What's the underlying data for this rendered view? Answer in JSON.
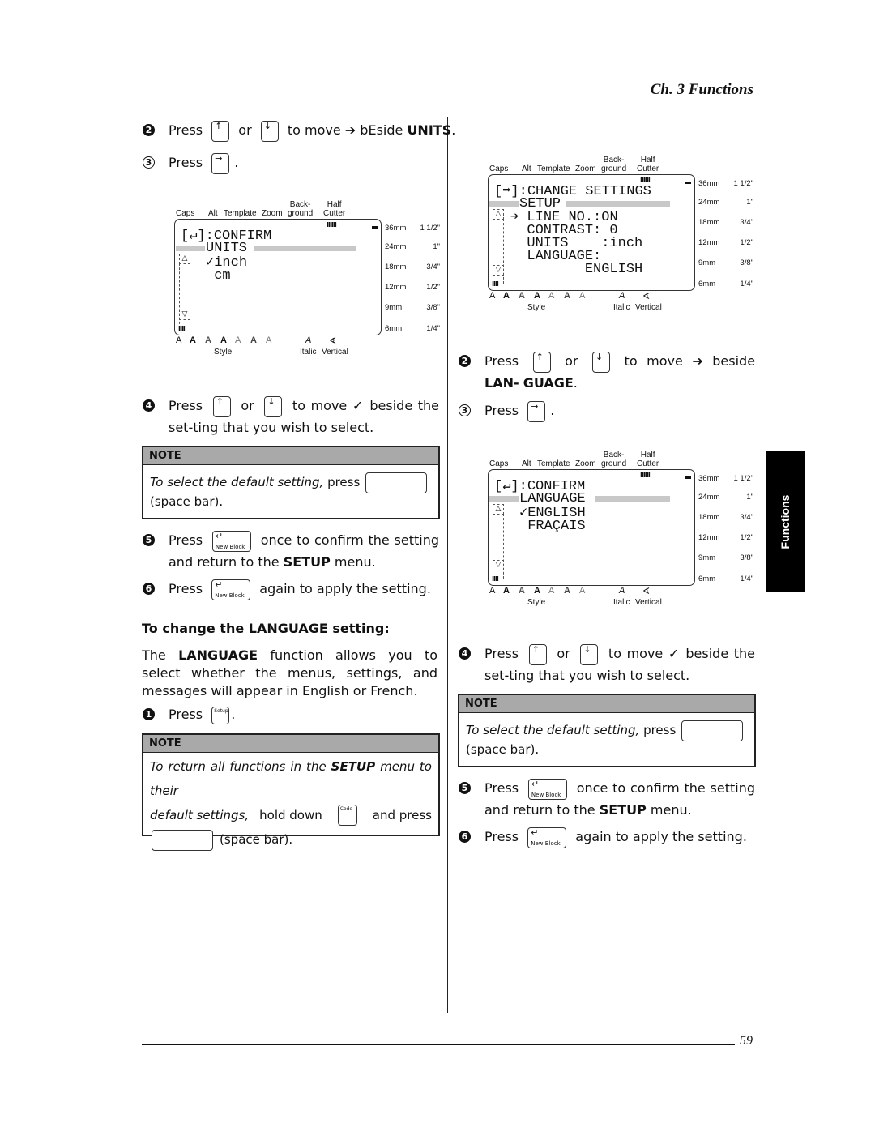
{
  "header": {
    "chapter": "Ch. 3 Functions"
  },
  "side_tab": {
    "label": "Functions"
  },
  "footer": {
    "page_number": "59"
  },
  "keys": {
    "up_icon": "↑",
    "down_icon": "↓",
    "right_icon": "→",
    "enter_icon": "↵",
    "new_block": "New Block",
    "setup": "Setup",
    "code": "Code"
  },
  "left": {
    "step2": {
      "num": "2",
      "press": "Press",
      "or": "or",
      "rest_a": "to move",
      "arrow": "➔",
      "rest_b": "bEside",
      "kw": "UNITS",
      "end": "."
    },
    "step3": {
      "num": "3",
      "press": "Press",
      "end": "."
    },
    "lcd1": {
      "icon": "[↵]",
      "title": ":CONFIRM",
      "section": "UNITS",
      "items": [
        "✓inch",
        " cm"
      ]
    },
    "step4": {
      "num": "4",
      "press": "Press",
      "or": "or",
      "rest": "to move ✓ beside the set-ting that you wish to select."
    },
    "note1": {
      "head": "NOTE",
      "italic": "To select the default setting,",
      "press": "press",
      "tail": "(space bar)."
    },
    "step5": {
      "num": "5",
      "press": "Press",
      "rest_a": "once to confirm the setting and return to the",
      "kw": "SETUP",
      "rest_b": "menu."
    },
    "step6": {
      "num": "6",
      "press": "Press",
      "rest": "again to apply the setting."
    },
    "subhead": "To change the LANGUAGE setting:",
    "para": {
      "a": "The",
      "kw": "LANGUAGE",
      "b": "function allows you to select whether the menus, settings, and messages will appear in English or French."
    },
    "step1": {
      "num": "1",
      "press": "Press",
      "end": "."
    },
    "note2": {
      "head": "NOTE",
      "l1_a": "To return all functions in the",
      "l1_kw": "SETUP",
      "l1_b": "menu to their",
      "l2_a": "default settings,",
      "l2_b": "hold down",
      "l2_c": "and press",
      "l3": "(space bar)."
    }
  },
  "right": {
    "lcd2": {
      "icon": "[➡]",
      "title": ":CHANGE SETTINGS",
      "section": "SETUP",
      "items": [
        "➔ LINE NO.:ON",
        "  CONTRAST: 0",
        "  UNITS    :inch",
        "  LANGUAGE:",
        "         ENGLISH"
      ]
    },
    "step2": {
      "num": "2",
      "press": "Press",
      "or": "or",
      "rest_a": "to move",
      "arrow": "➔",
      "rest_b": "beside",
      "kw1": "LAN-",
      "kw2": "GUAGE",
      "end": "."
    },
    "step3": {
      "num": "3",
      "press": "Press",
      "end": "."
    },
    "lcd3": {
      "icon": "[↵]",
      "title": ":CONFIRM",
      "section": "LANGUAGE",
      "items": [
        "✓ENGLISH",
        " FRAÇAIS"
      ]
    },
    "step4": {
      "num": "4",
      "press": "Press",
      "or": "or",
      "rest": "to move ✓ beside the set-ting that you wish to select."
    },
    "note1": {
      "head": "NOTE",
      "italic": "To select the default setting,",
      "press": "press",
      "tail": "(space bar)."
    },
    "step5": {
      "num": "5",
      "press": "Press",
      "rest_a": "once to confirm the setting and return to the",
      "kw": "SETUP",
      "rest_b": "menu."
    },
    "step6": {
      "num": "6",
      "press": "Press",
      "rest": "again to apply the setting."
    }
  },
  "lcd_common": {
    "top_labels": [
      "Caps",
      "Alt",
      "Template",
      "Zoom",
      "Back-\nground",
      "Half\nCutter"
    ],
    "sizes": [
      {
        "mm": "36mm",
        "in": "1 1/2\""
      },
      {
        "mm": "24mm",
        "in": "1\""
      },
      {
        "mm": "18mm",
        "in": "3/4\""
      },
      {
        "mm": "12mm",
        "in": "1/2\""
      },
      {
        "mm": "9mm",
        "in": "3/8\""
      },
      {
        "mm": "6mm",
        "in": "1/4\""
      }
    ],
    "style_glyphs": [
      "A",
      "A",
      "A",
      "A",
      "A",
      "A",
      "A"
    ],
    "italic_glyph": "A",
    "vertical_glyph": "∢",
    "style_label": "Style",
    "italic_label": "Italic",
    "vertical_label": "Vertical",
    "tick_marks_top": "IIIIII",
    "tick_marks_bottom": "IIII"
  }
}
